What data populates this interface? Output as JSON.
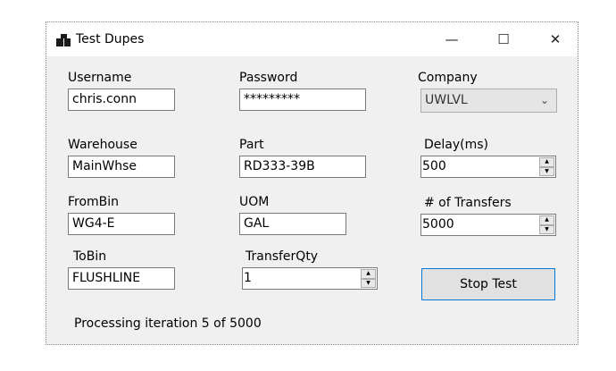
{
  "window": {
    "title": "Test Dupes",
    "controls": {
      "minimize": "—",
      "maximize": "☐",
      "close": "✕"
    }
  },
  "fields": {
    "username": {
      "label": "Username",
      "value": "chris.conn"
    },
    "password": {
      "label": "Password",
      "value": "*********"
    },
    "company": {
      "label": "Company",
      "value": "UWLVL"
    },
    "warehouse": {
      "label": "Warehouse",
      "value": "MainWhse"
    },
    "part": {
      "label": "Part",
      "value": "RD333-39B"
    },
    "delay": {
      "label": "Delay(ms)",
      "value": "500"
    },
    "frombin": {
      "label": "FromBin",
      "value": "WG4-E"
    },
    "uom": {
      "label": "UOM",
      "value": "GAL"
    },
    "transfers": {
      "label": "# of Transfers",
      "value": "5000"
    },
    "tobin": {
      "label": "ToBin",
      "value": "FLUSHLINE"
    },
    "transferqty": {
      "label": "TransferQty",
      "value": "1"
    }
  },
  "buttons": {
    "stop_test": "Stop Test"
  },
  "status": "Processing iteration 5 of 5000",
  "icons": {
    "app": "app-icon",
    "dropdown": "chevron-down-icon",
    "spin_up": "spin-up-icon",
    "spin_down": "spin-down-icon"
  },
  "colors": {
    "window_bg": "#f0f0f0",
    "accent_border": "#0078d7"
  }
}
